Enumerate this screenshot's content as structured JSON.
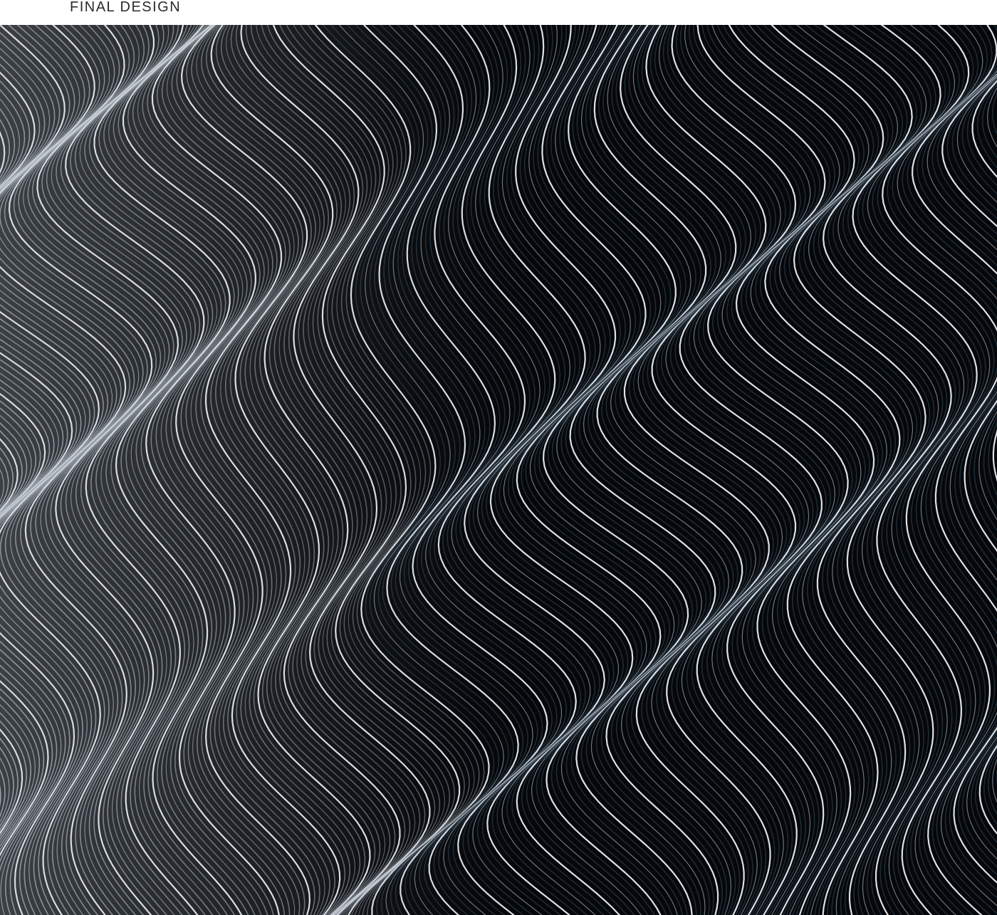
{
  "header": {
    "title": "FINAL DESIGN"
  },
  "artwork": {
    "description_icon": "wave-pattern-icon",
    "colors": {
      "background": "#05070a",
      "line_light": "#e9edf2",
      "line_mid": "#9aa4ae",
      "shade_blue": "#23303c"
    }
  }
}
